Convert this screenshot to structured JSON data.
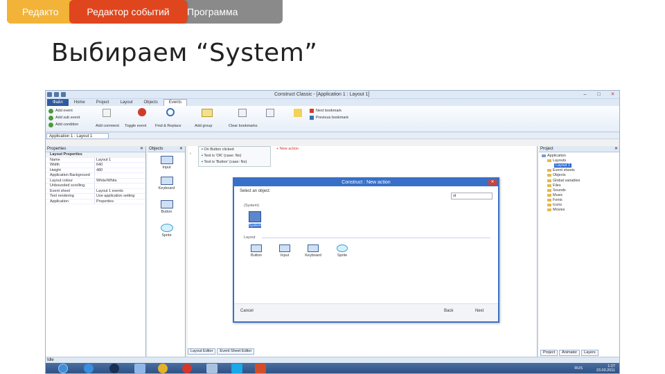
{
  "slide": {
    "tab1": "Редакто",
    "tab2": "Редактор событий",
    "tab3": "Программа",
    "title": "Выбираем “System”"
  },
  "app": {
    "title": "Construct Classic - [Application 1 : Layout 1]",
    "ribbon_tabs": [
      "Файл",
      "Home",
      "Project",
      "Layout",
      "Objects",
      "Events"
    ],
    "ribbon_buttons": [
      "Add event",
      "Add sub event",
      "Add condition",
      "Add comment",
      "Toggle event",
      "Find & Replace",
      "Add group",
      "Clear bookmarks",
      "Next bookmark",
      "Previous bookmark"
    ],
    "document_tab": "Application 1 : Layout 1",
    "properties": {
      "header": "Properties",
      "group": "Layout Properties",
      "rows": [
        {
          "k": "Name",
          "v": "Layout 1"
        },
        {
          "k": "Width",
          "v": "640"
        },
        {
          "k": "Height",
          "v": "480"
        },
        {
          "k": "Application Background",
          "v": ""
        },
        {
          "k": "Layout colour",
          "v": "White/White"
        },
        {
          "k": "Unbounded scrolling",
          "v": ""
        },
        {
          "k": "Event sheet",
          "v": "Layout 1 events"
        },
        {
          "k": "Text rendering",
          "v": "Use application setting"
        },
        {
          "k": "Application",
          "v": "Properties"
        }
      ]
    },
    "objects_panel": {
      "header": "Objects",
      "items": [
        "Input",
        "Keyboard",
        "Button",
        "Sprite"
      ]
    },
    "events": {
      "rows": [
        "On Button clicked",
        "Text is 'OK' (case: No)",
        "Text is 'Button' (case: No)"
      ],
      "new_action": "+ New action"
    },
    "bottom_tabs": [
      "Layout Editor",
      "Event Sheet Editor"
    ],
    "project_panel": {
      "header": "Project",
      "items": [
        "Application",
        "Layouts",
        "Layout 1",
        "Event sheets",
        "Objects",
        "Global variables",
        "Files",
        "Sounds",
        "Music",
        "Fonts",
        "Icons",
        "Movies"
      ]
    },
    "panel_tabs": [
      "Project",
      "Animator",
      "Layers"
    ],
    "status": "Idle",
    "taskbar_lang": "RUS",
    "taskbar_clock": [
      "1:27",
      "23.03.2011"
    ]
  },
  "dialog": {
    "title": "Construct : New action",
    "prompt": "Select an object:",
    "search_value": "ol",
    "section_system": "(System)",
    "system_label": "System",
    "section_layout": "Layout",
    "layout_objects": [
      "Button",
      "Input",
      "Keyboard",
      "Sprite"
    ],
    "buttons": {
      "cancel": "Cancel",
      "back": "Back",
      "next": "Next"
    }
  }
}
